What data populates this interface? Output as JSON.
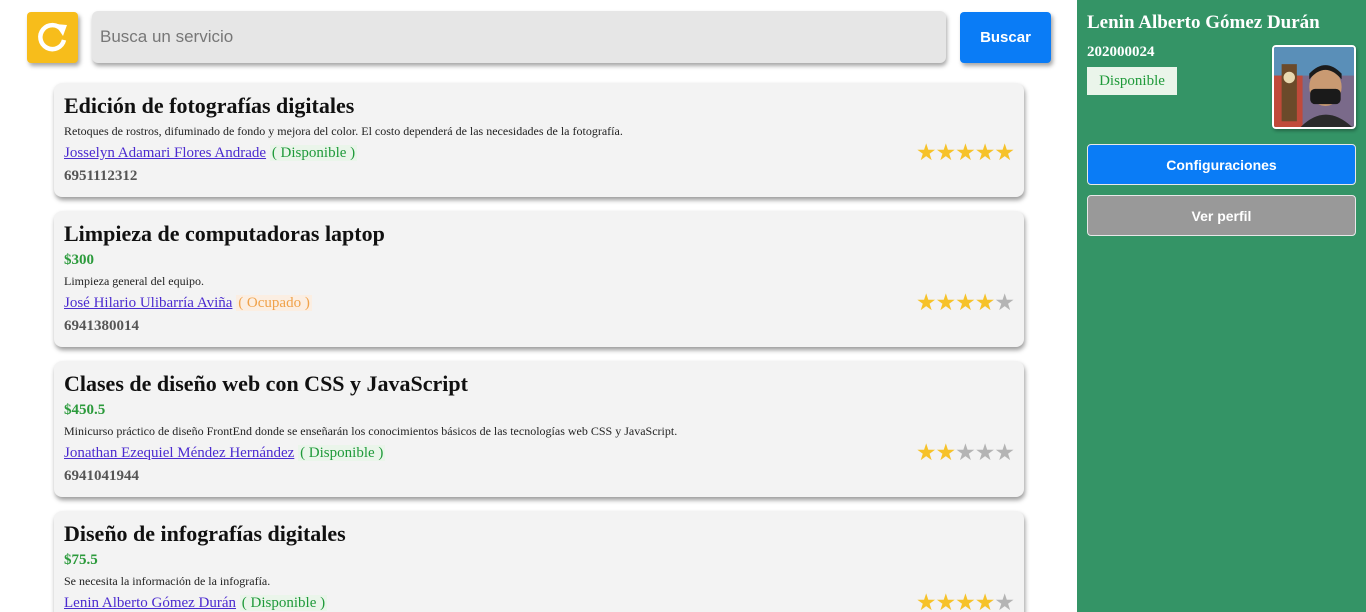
{
  "toolbar": {
    "refresh_icon": "refresh-icon",
    "search_placeholder": "Busca un servicio",
    "search_value": "",
    "search_label": "Buscar"
  },
  "services": [
    {
      "title": "Edición de fotografías digitales",
      "price": "",
      "description": "Retoques de rostros, difuminado de fondo y mejora del color. El costo dependerá de las necesidades de la fotografía.",
      "provider": "Josselyn Adamari Flores Andrade",
      "status": "( Disponible )",
      "status_kind": "available",
      "phone": "6951112312",
      "rating": 5
    },
    {
      "title": "Limpieza de computadoras laptop",
      "price": "$300",
      "description": "Limpieza general del equipo.",
      "provider": "José Hilario Ulibarría Aviña",
      "status": "( Ocupado )",
      "status_kind": "busy",
      "phone": "6941380014",
      "rating": 4
    },
    {
      "title": "Clases de diseño web con CSS y JavaScript",
      "price": "$450.5",
      "description": "Minicurso práctico de diseño FrontEnd donde se enseñarán los conocimientos básicos de las tecnologías web CSS y JavaScript.",
      "provider": "Jonathan Ezequiel Méndez Hernández",
      "status": "( Disponible )",
      "status_kind": "available",
      "phone": "6941041944",
      "rating": 2
    },
    {
      "title": "Diseño de infografías digitales",
      "price": "$75.5",
      "description": "Se necesita la información de la infografía.",
      "provider": "Lenin Alberto Gómez Durán",
      "status": "( Disponible )",
      "status_kind": "available",
      "phone": "",
      "rating": 4
    }
  ],
  "sidebar": {
    "name": "Lenin Alberto Gómez Durán",
    "id": "202000024",
    "status": "Disponible",
    "config_label": "Configuraciones",
    "profile_label": "Ver perfil"
  },
  "colors": {
    "accent_blue": "#0a7cf6",
    "refresh_yellow": "#f7bd1b",
    "sidebar_green": "#349466",
    "available_green": "#1f9a3a",
    "busy_orange": "#f0a24a",
    "star_gold": "#f6c22a",
    "star_gray": "#b4b4b4"
  }
}
